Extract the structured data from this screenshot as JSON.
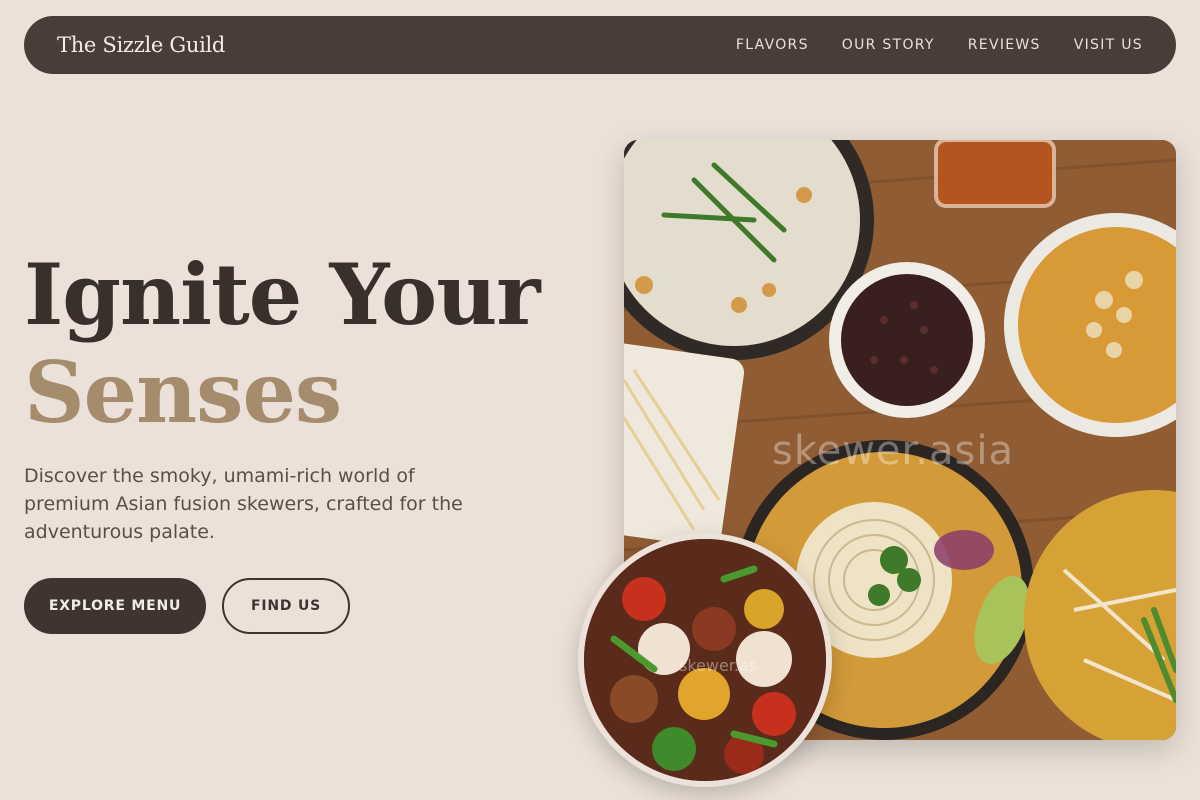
{
  "nav": {
    "brand": "The Sizzle Guild",
    "links": [
      "FLAVORS",
      "OUR STORY",
      "REVIEWS",
      "VISIT US"
    ]
  },
  "hero": {
    "title_line1": "Ignite Your",
    "title_line2": "Senses",
    "description": "Discover the smoky, umami-rich world of premium Asian fusion skewers, crafted for the adventurous palate.",
    "primary_button": "EXPLORE MENU",
    "secondary_button": "FIND US"
  },
  "media": {
    "main_photo_watermark": "skewer.asia",
    "thumb_watermark": "skewer.as"
  },
  "colors": {
    "background": "#ebe1d8",
    "nav_bg": "#4a3d38",
    "accent": "#a58c6d",
    "dark": "#3f3430"
  }
}
